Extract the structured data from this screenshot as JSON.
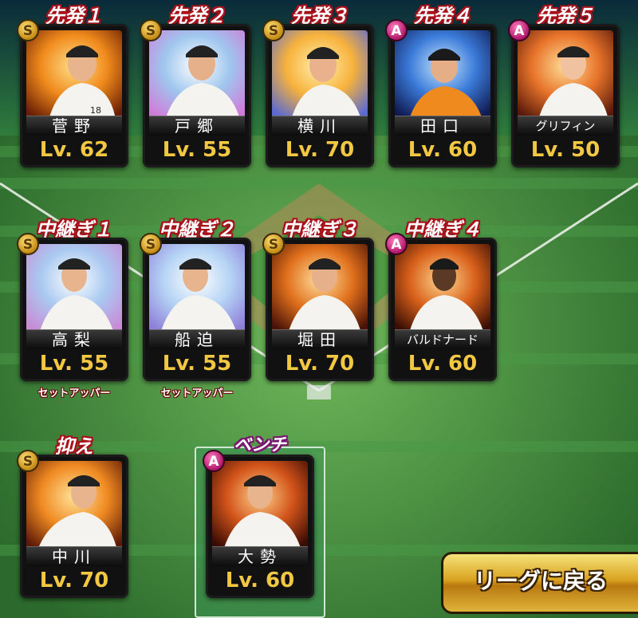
{
  "colors": {
    "role_outline": "#a8101a",
    "bench_outline": "#7a1870",
    "level_text": "#f2c843",
    "rank_s": "#d8a021",
    "rank_a": "#c81f78"
  },
  "starters": [
    {
      "role": "先発１",
      "rank": "S",
      "name": "菅野",
      "level": "Lv. 62"
    },
    {
      "role": "先発２",
      "rank": "S",
      "name": "戸郷",
      "level": "Lv. 55"
    },
    {
      "role": "先発３",
      "rank": "S",
      "name": "横川",
      "level": "Lv. 70"
    },
    {
      "role": "先発４",
      "rank": "A",
      "name": "田口",
      "level": "Lv. 60"
    },
    {
      "role": "先発５",
      "rank": "A",
      "name": "グリフィン",
      "level": "Lv. 50"
    }
  ],
  "relievers": [
    {
      "role": "中継ぎ１",
      "rank": "S",
      "name": "高梨",
      "level": "Lv. 55",
      "subrole": "セットアッパー"
    },
    {
      "role": "中継ぎ２",
      "rank": "S",
      "name": "船迫",
      "level": "Lv. 55",
      "subrole": "セットアッパー"
    },
    {
      "role": "中継ぎ３",
      "rank": "S",
      "name": "堀田",
      "level": "Lv. 70",
      "subrole": ""
    },
    {
      "role": "中継ぎ４",
      "rank": "A",
      "name": "バルドナード",
      "level": "Lv. 60",
      "subrole": ""
    }
  ],
  "closer": {
    "role": "抑え",
    "rank": "S",
    "name": "中川",
    "level": "Lv. 70"
  },
  "bench": {
    "role": "ベンチ",
    "rank": "A",
    "name": "大勢",
    "level": "Lv. 60"
  },
  "return_button": {
    "label": "リーグに戻る"
  }
}
